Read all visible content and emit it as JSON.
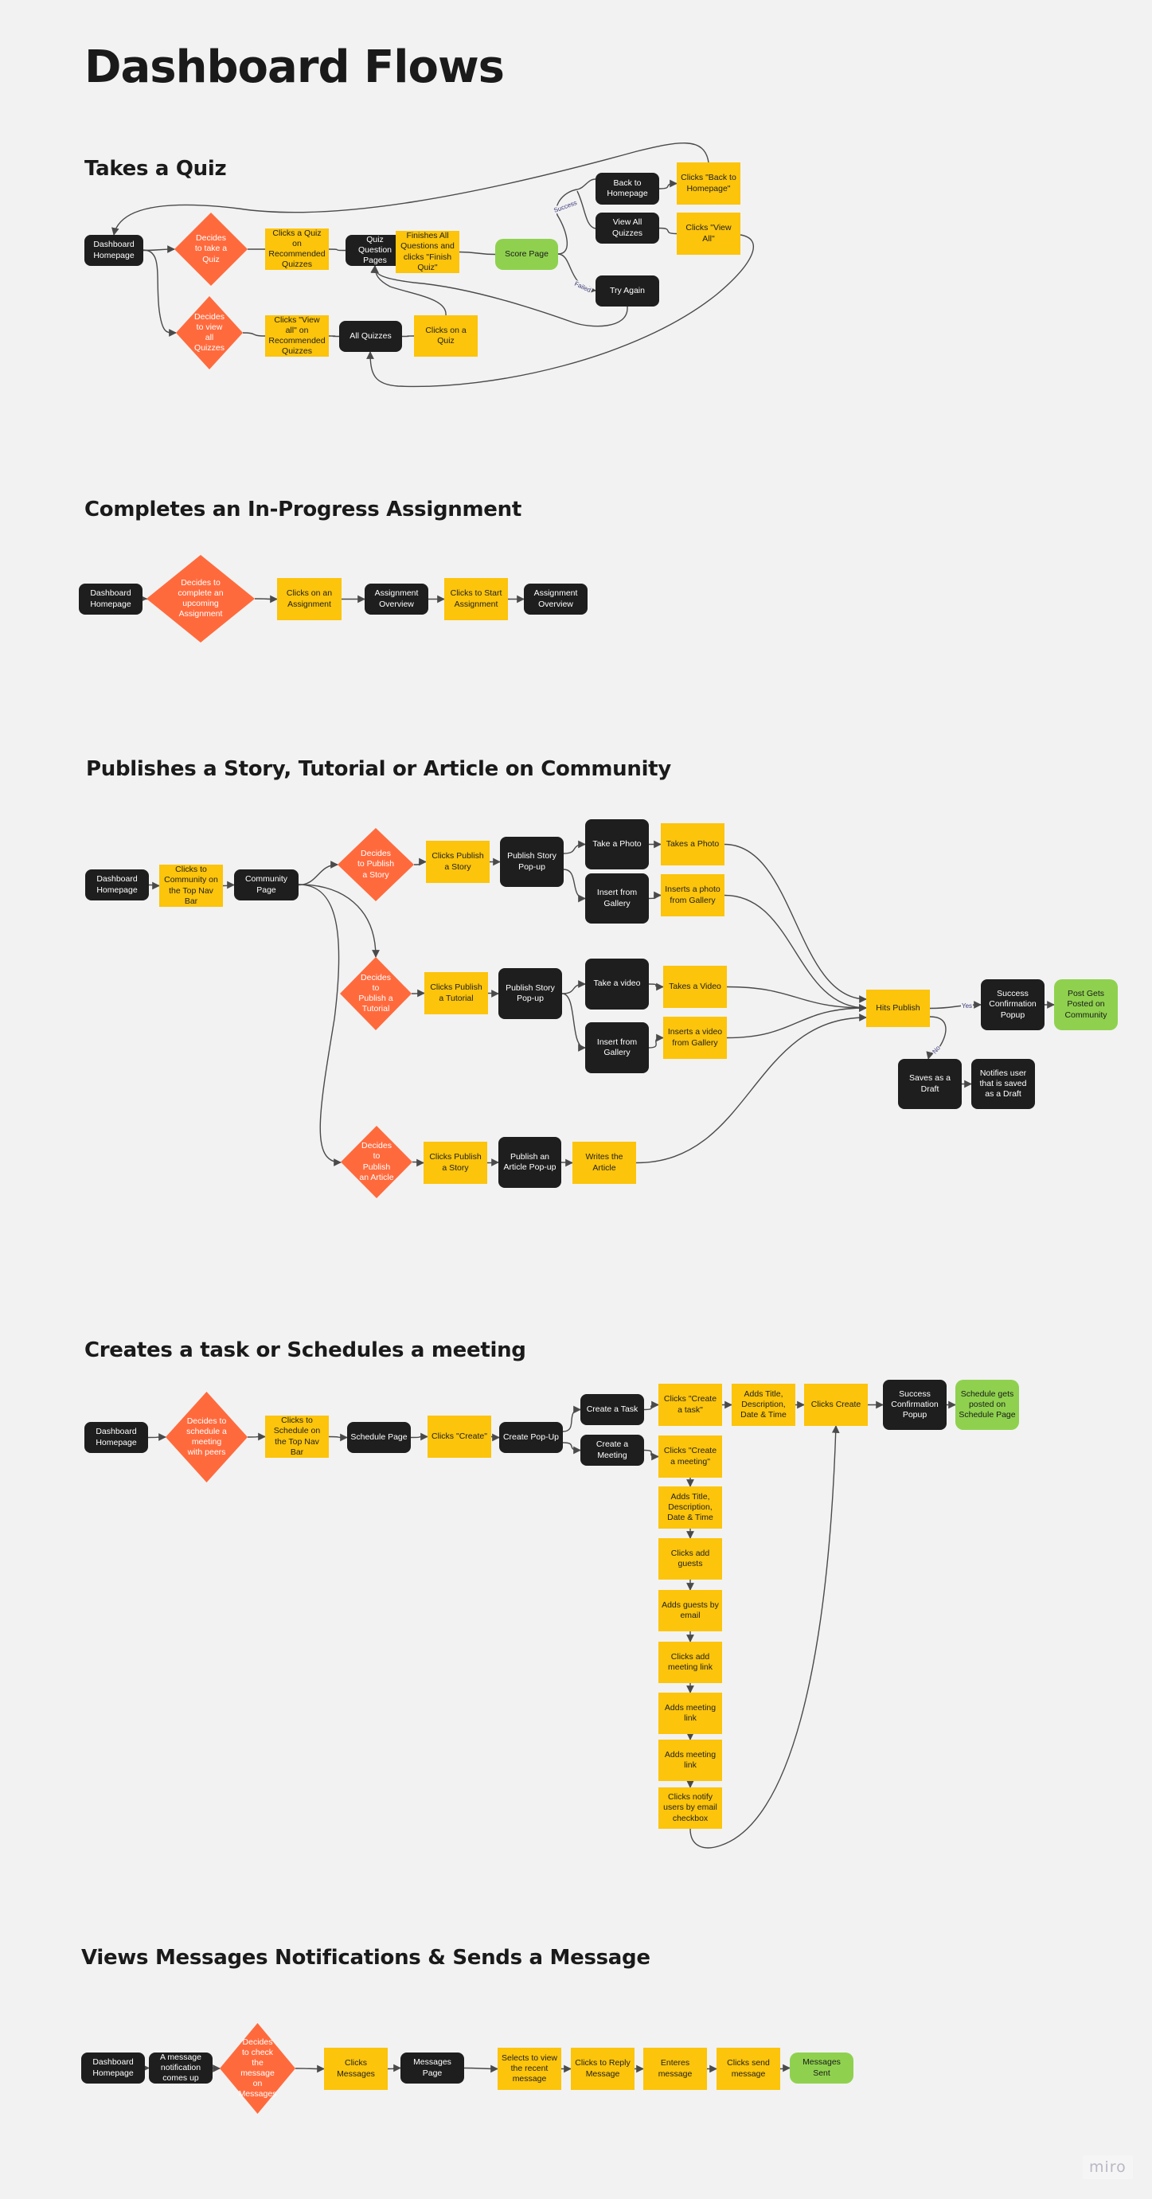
{
  "page": {
    "title": "Dashboard Flows",
    "watermark": "miro"
  },
  "colors": {
    "background": "#f2f2f2",
    "screen_node": "#1e1e1e",
    "action_node": "#fcc40b",
    "decision_node": "#ff6a3d",
    "end_node": "#8fd14f",
    "edge": "#4a4a4a"
  },
  "legend_types": {
    "screen": "dark rounded box (page / screen)",
    "action": "yellow box (user action)",
    "decision": "orange diamond (user decision)",
    "end": "green rounded box (end state)"
  },
  "flows": {
    "quiz": {
      "title": "Takes a Quiz",
      "nodes": {
        "home": "Dashboard Homepage",
        "dec_take": "Decides to take a Quiz",
        "click_rec": "Clicks a Quiz on Recommended Quizzes",
        "qpages": "Quiz Question Pages",
        "finish": "Finishes All Questions and clicks \"Finish Quiz\"",
        "score": "Score Page",
        "back_home": "Back to Homepage",
        "click_back": "Clicks \"Back to Homepage\"",
        "view_all": "View All Quizzes",
        "click_view_all": "Clicks \"View All\"",
        "try_again": "Try Again",
        "dec_view": "Decides to view all Quizzes",
        "click_view_rec": "Clicks \"View all\" on Recommended Quizzes",
        "all_quizzes": "All Quizzes",
        "click_quiz": "Clicks on a Quiz"
      },
      "edge_labels": {
        "success": "Success",
        "failed": "Failed"
      }
    },
    "assignment": {
      "title": "Completes an In-Progress Assignment",
      "nodes": {
        "home": "Dashboard Homepage",
        "dec": "Decides to complete an upcoming Assignment",
        "click": "Clicks on an Assignment",
        "overview1": "Assignment Overview",
        "start": "Clicks to Start Assignment",
        "overview2": "Assignment Overview"
      }
    },
    "community": {
      "title": "Publishes a Story, Tutorial or Article on Community",
      "nodes": {
        "home": "Dashboard Homepage",
        "click_comm": "Clicks to Community on the Top Nav Bar",
        "comm_page": "Community Page",
        "dec_story": "Decides to Publish a Story",
        "click_story": "Clicks Publish a Story",
        "story_popup": "Publish Story Pop-up",
        "take_photo": "Take a Photo",
        "takes_photo": "Takes a Photo",
        "insert_gallery1": "Insert from Gallery",
        "inserts_photo": "Inserts a photo from Gallery",
        "dec_tut": "Decides to Publish a Tutorial",
        "click_tut": "Clicks Publish a Tutorial",
        "tut_popup": "Publish Story Pop-up",
        "take_video": "Take a video",
        "takes_video": "Takes a Video",
        "insert_gallery2": "Insert from Gallery",
        "inserts_video": "Inserts a video from Gallery",
        "dec_article": "Decides to Publish an Article",
        "click_article": "Clicks Publish a Story",
        "article_popup": "Publish an Article Pop-up",
        "writes": "Writes the Article",
        "hits_publish": "Hits Publish",
        "success": "Success Confirmation Popup",
        "posted": "Post Gets Posted on Community",
        "draft": "Saves as a Draft",
        "notify": "Notifies user that is saved as a Draft"
      },
      "edge_labels": {
        "yes": "Yes",
        "no": "No"
      }
    },
    "schedule": {
      "title": "Creates a task or Schedules a meeting",
      "nodes": {
        "home": "Dashboard Homepage",
        "dec": "Decides to schedule a meeting with peers",
        "click_sched": "Clicks to Schedule on the Top Nav Bar",
        "sched_page": "Schedule Page",
        "click_create": "Clicks \"Create\"",
        "create_popup": "Create Pop-Up",
        "create_task": "Create a Task",
        "create_meeting": "Create a Meeting",
        "click_task": "Clicks \"Create a task\"",
        "adds_title1": "Adds Title, Description, Date & Time",
        "clicks_create": "Clicks Create",
        "success": "Success Confirmation Popup",
        "posted": "Schedule gets posted on Schedule Page",
        "click_meeting": "Clicks \"Create a meeting\"",
        "adds_title2": "Adds Title, Description, Date & Time",
        "add_guests": "Clicks add guests",
        "guests_email": "Adds guests by email",
        "click_link": "Clicks add meeting link",
        "adds_link1": "Adds meeting link",
        "adds_link2": "Adds meeting link",
        "notify": "Clicks notify users by email checkbox"
      }
    },
    "messages": {
      "title": "Views Messages Notifications & Sends a Message",
      "nodes": {
        "home": "Dashboard Homepage",
        "notif": "A message notification comes up",
        "dec": "Decides to check the message on Messages",
        "click_msgs": "Clicks Messages",
        "msgs_page": "Messages Page",
        "select": "Selects to view the recent message",
        "reply": "Clicks to Reply Message",
        "enter": "Enteres message",
        "send": "Clicks send message",
        "sent": "Messages Sent"
      }
    }
  }
}
